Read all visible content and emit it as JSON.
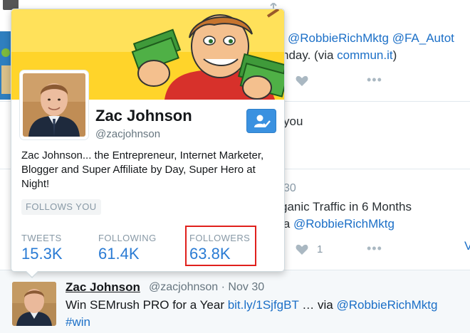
{
  "timeline": {
    "tweet1": {
      "mention_line": "@RobbieRichMktg @FA_Autot",
      "text_prefix": "nday. (via ",
      "via_link": "commun.it",
      "text_suffix": ")"
    },
    "tweet2": {
      "text": "you"
    },
    "tweet3_bg": {
      "number_fragment": "30",
      "headline": "ganic Traffic in 6 Months",
      "via_prefix": "ia ",
      "via_handle": "@RobbieRichMktg",
      "like_count": "1",
      "reply_fragment": "V"
    }
  },
  "card": {
    "name": "Zac Johnson",
    "handle": "@zacjohnson",
    "bio": "Zac Johnson... the Entrepreneur, Internet Marketer, Blogger and Super Affiliate by Day, Super Hero at Night!",
    "follows_you": "FOLLOWS YOU",
    "stats": {
      "tweets_label": "TWEETS",
      "tweets_value": "15.3K",
      "following_label": "FOLLOWING",
      "following_value": "61.4K",
      "followers_label": "FOLLOWERS",
      "followers_value": "63.8K"
    },
    "follow_button_icon": "user-check-icon",
    "colors": {
      "accent": "#2a7bd4",
      "highlight": "#e0201c",
      "button": "#3a91e0"
    }
  },
  "tweet": {
    "name": "Zac Johnson",
    "handle": "@zacjohnson",
    "dot": "·",
    "date": "Nov 30",
    "text": "Win SEMrush PRO for a Year ",
    "link": "bit.ly/1SjfgBT",
    "ellipsis_via": " … via ",
    "mention": "@RobbieRichMktg",
    "hashtag": "#win"
  }
}
